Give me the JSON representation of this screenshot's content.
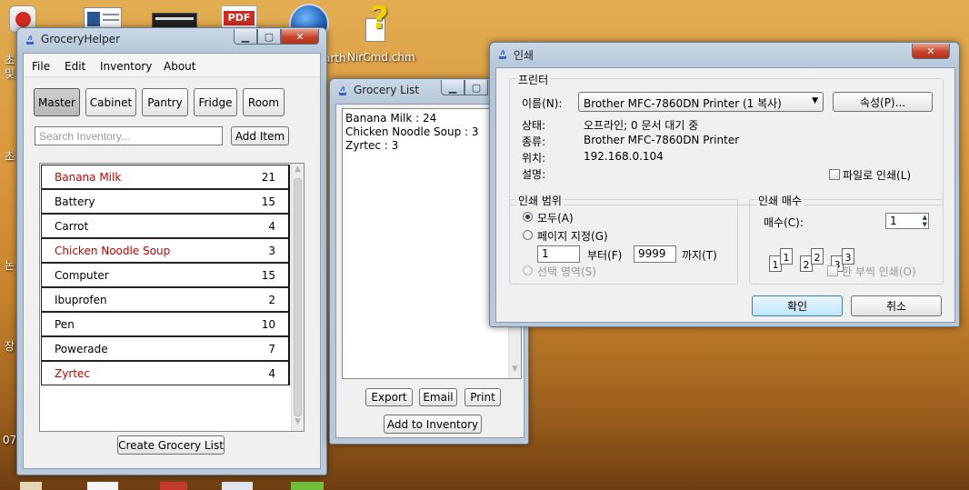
{
  "desktop": {
    "icons": [
      {
        "label": "NirCmd.chm",
        "icon": "help-file-icon"
      }
    ],
    "partial_labels": {
      "google_earth": "arth",
      "left_edge": [
        "초",
        "및",
        "초",
        "논",
        "장",
        "07"
      ]
    }
  },
  "grocery_helper": {
    "title": "GroceryHelper",
    "menu": [
      "File",
      "Edit",
      "Inventory",
      "About"
    ],
    "tabs": [
      "Master",
      "Cabinet",
      "Pantry",
      "Fridge",
      "Room"
    ],
    "selected_tab": "Master",
    "search_placeholder": "Search Inventory...",
    "add_item_label": "Add Item",
    "items": [
      {
        "name": "Banana Milk",
        "qty": "21",
        "highlight": true
      },
      {
        "name": "Battery",
        "qty": "15",
        "highlight": false
      },
      {
        "name": "Carrot",
        "qty": "4",
        "highlight": false
      },
      {
        "name": "Chicken Noodle Soup",
        "qty": "3",
        "highlight": true
      },
      {
        "name": "Computer",
        "qty": "15",
        "highlight": false
      },
      {
        "name": "Ibuprofen",
        "qty": "2",
        "highlight": false
      },
      {
        "name": "Pen",
        "qty": "10",
        "highlight": false
      },
      {
        "name": "Powerade",
        "qty": "7",
        "highlight": false
      },
      {
        "name": "Zyrtec",
        "qty": "4",
        "highlight": true
      }
    ],
    "create_list_label": "Create Grocery List",
    "highlight_color": "#cc0000"
  },
  "grocery_list": {
    "title": "Grocery List",
    "lines": [
      "Banana Milk : 24",
      "Chicken Noodle Soup : 3",
      "Zyrtec : 3"
    ],
    "export_label": "Export",
    "email_label": "Email",
    "print_label": "Print",
    "add_to_inventory_label": "Add to Inventory"
  },
  "print_dialog": {
    "title": "인쇄",
    "printer_group": "프린터",
    "name_label": "이름(N):",
    "printer_name": "Brother MFC-7860DN Printer (1 복사)",
    "properties_label": "속성(P)...",
    "status_label": "상태:",
    "status_value": "오프라인; 0 문서 대기 중",
    "type_label": "종류:",
    "type_value": "Brother MFC-7860DN Printer",
    "where_label": "위치:",
    "where_value": "192.168.0.104",
    "comment_label": "설명:",
    "print_to_file_label": "파일로 인쇄(L)",
    "range_group": "인쇄 범위",
    "all_label": "모두(A)",
    "pages_label": "페이지 지정(G)",
    "from_value": "1",
    "from_label": "부터(F)",
    "to_value": "9999",
    "to_label": "까지(T)",
    "selection_label": "선택 영역(S)",
    "copies_group": "인쇄 매수",
    "copies_label": "매수(C):",
    "copies_value": "1",
    "collate_label": "한 부씩 인쇄(O)",
    "ok_label": "확인",
    "cancel_label": "취소"
  }
}
